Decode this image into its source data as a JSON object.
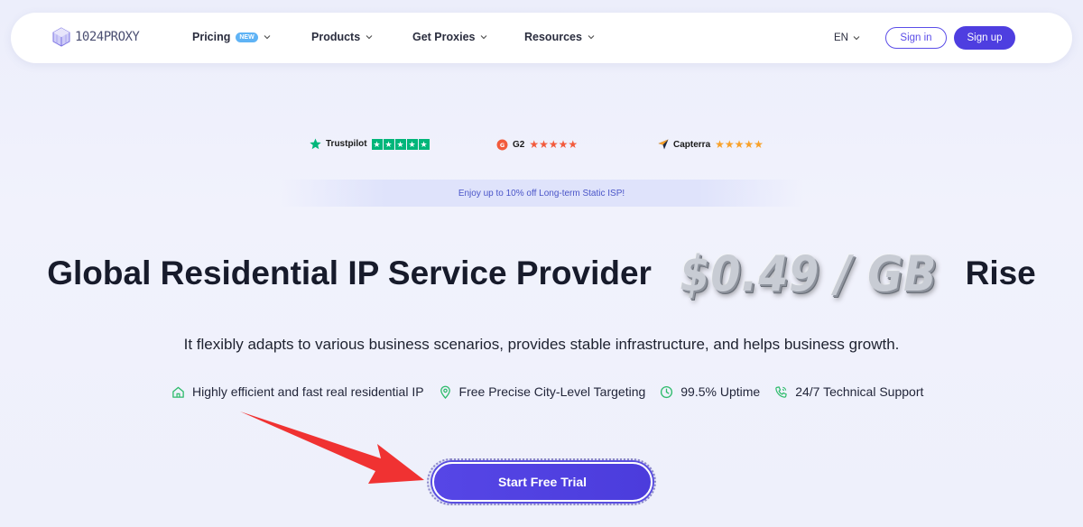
{
  "nav": {
    "logo_text": "1024PROXY",
    "items": [
      {
        "label": "Pricing",
        "badge": "NEW"
      },
      {
        "label": "Products"
      },
      {
        "label": "Get Proxies"
      },
      {
        "label": "Resources"
      }
    ],
    "language": "EN",
    "sign_in": "Sign in",
    "sign_up": "Sign up"
  },
  "ratings": [
    {
      "name": "Trustpilot",
      "stars": 5,
      "icon": "trustpilot-star-icon"
    },
    {
      "name": "G2",
      "stars": 5,
      "icon": "g2-logo-icon"
    },
    {
      "name": "Capterra",
      "stars": 5,
      "icon": "capterra-logo-icon"
    }
  ],
  "promo": "Enjoy up to 10% off Long-term Static ISP!",
  "hero": {
    "headline_prefix": "Global Residential IP Service Provider",
    "price": "$0.49 / GB",
    "headline_suffix": "Rise",
    "subtitle": "It flexibly adapts to various business scenarios, provides stable infrastructure, and helps business growth."
  },
  "features": [
    {
      "icon": "home-icon",
      "label": "Highly efficient and fast real residential IP"
    },
    {
      "icon": "location-pin-icon",
      "label": "Free Precise City-Level Targeting"
    },
    {
      "icon": "clock-icon",
      "label": "99.5% Uptime"
    },
    {
      "icon": "phone-icon",
      "label": "24/7 Technical Support"
    }
  ],
  "cta": "Start Free Trial",
  "colors": {
    "brand": "#4e3ee0",
    "feature_icon": "#2dbb6b",
    "arrow": "#f03232",
    "trustpilot": "#00b67a"
  }
}
